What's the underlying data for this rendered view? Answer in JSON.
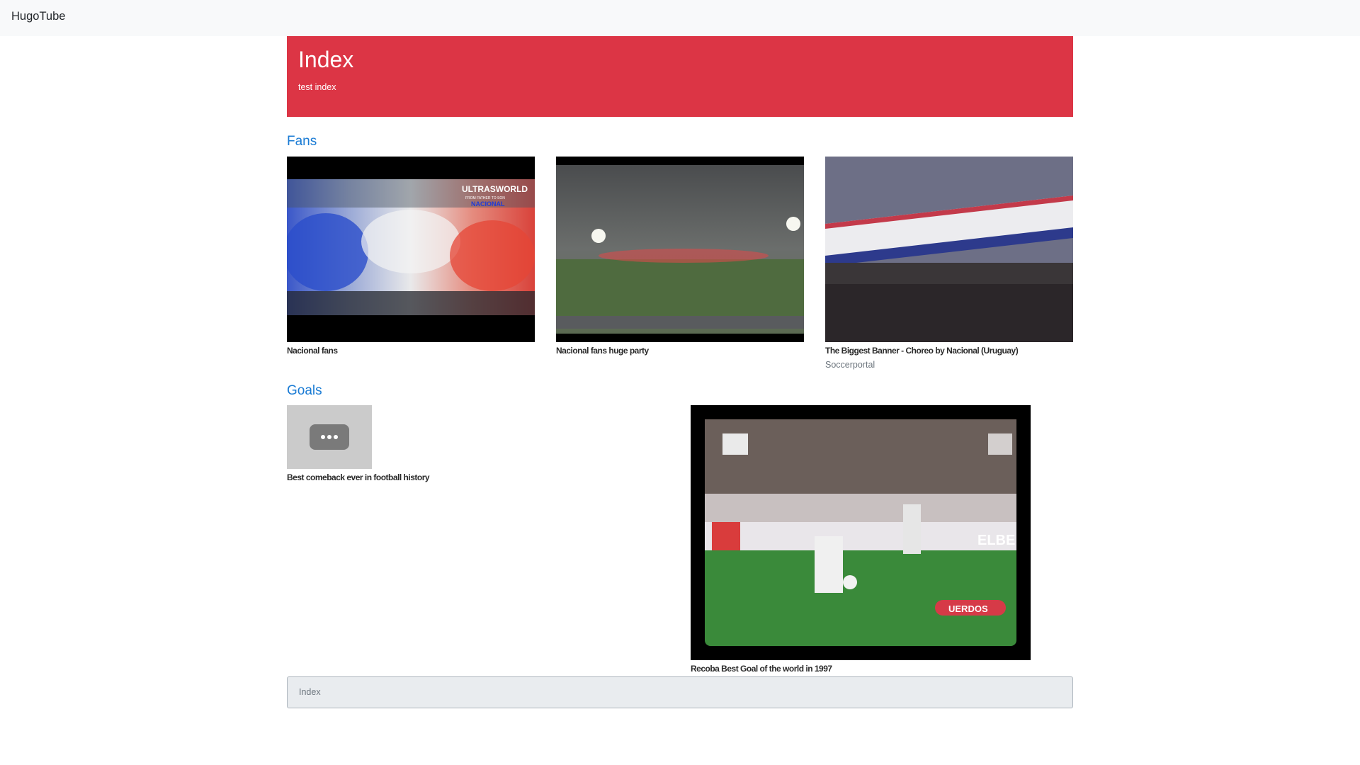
{
  "nav": {
    "brand": "HugoTube"
  },
  "header": {
    "title": "Index",
    "subtitle": "test index"
  },
  "sections": [
    {
      "title": "Fans",
      "videos": [
        {
          "title": "Nacional fans",
          "overlay_text": [
            "ULTRASWORLD",
            "FROM FATHER TO SON",
            "NACIONAL"
          ]
        },
        {
          "title": "Nacional fans huge party"
        },
        {
          "title": "The Biggest Banner - Choreo by Nacional (Uruguay)",
          "channel": "Soccerportal"
        }
      ]
    },
    {
      "title": "Goals",
      "videos": [
        {
          "title": "Best comeback ever in football history"
        },
        {
          "title": "Recoba Best Goal of the world in 1997",
          "overlay_text": [
            "ELBE",
            "UERDOS"
          ]
        }
      ]
    }
  ],
  "footer": {
    "link": "Index"
  },
  "colors": {
    "navbar": "#f8f9fa",
    "jumbotron": "#dc3545",
    "section_link": "#1a7bd4",
    "footer": "#e9ecef"
  }
}
